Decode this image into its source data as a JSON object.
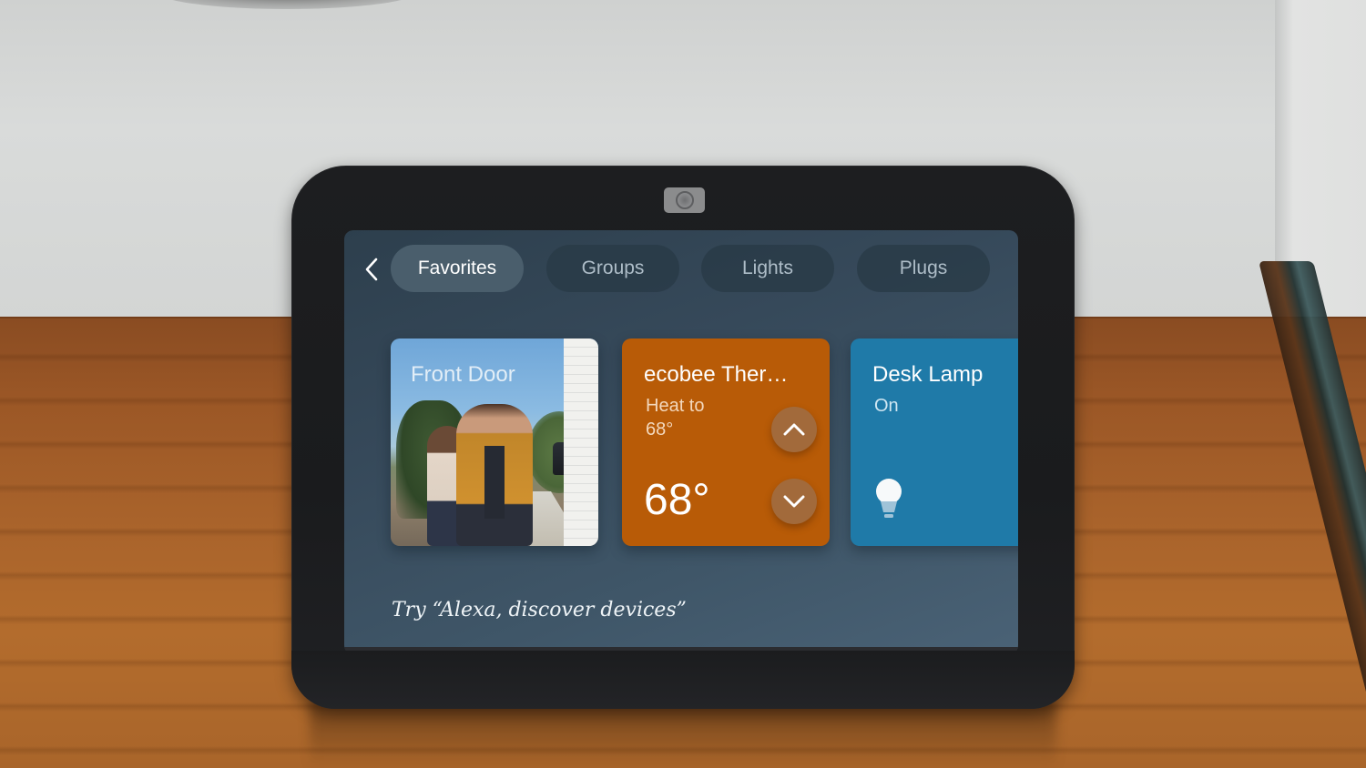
{
  "device": {
    "name": "Echo Show smart display",
    "camera_icon": "camera-icon"
  },
  "tabs": {
    "back_icon": "chevron-left-icon",
    "items": [
      {
        "label": "Favorites",
        "active": true
      },
      {
        "label": "Groups",
        "active": false
      },
      {
        "label": "Lights",
        "active": false
      },
      {
        "label": "Plugs",
        "active": false
      }
    ]
  },
  "cards": {
    "front_door": {
      "title": "Front Door",
      "type": "camera-feed"
    },
    "thermostat": {
      "title": "ecobee Ther…",
      "subtitle_line1": "Heat to",
      "subtitle_line2": "68°",
      "current_temp": "68°",
      "up_icon": "chevron-up-icon",
      "down_icon": "chevron-down-icon",
      "color": "#b85b07"
    },
    "desk_lamp": {
      "title": "Desk Lamp",
      "status": "On",
      "icon": "lightbulb-icon",
      "color": "#1f7aa8"
    }
  },
  "hint": {
    "text": "Try “Alexa, discover devices”"
  },
  "colors": {
    "screen_bg": "#36495a",
    "tab_active_bg": "#4a5e6c",
    "tab_inactive_bg": "#283a46",
    "tab_inactive_text": "#aebdc8"
  }
}
